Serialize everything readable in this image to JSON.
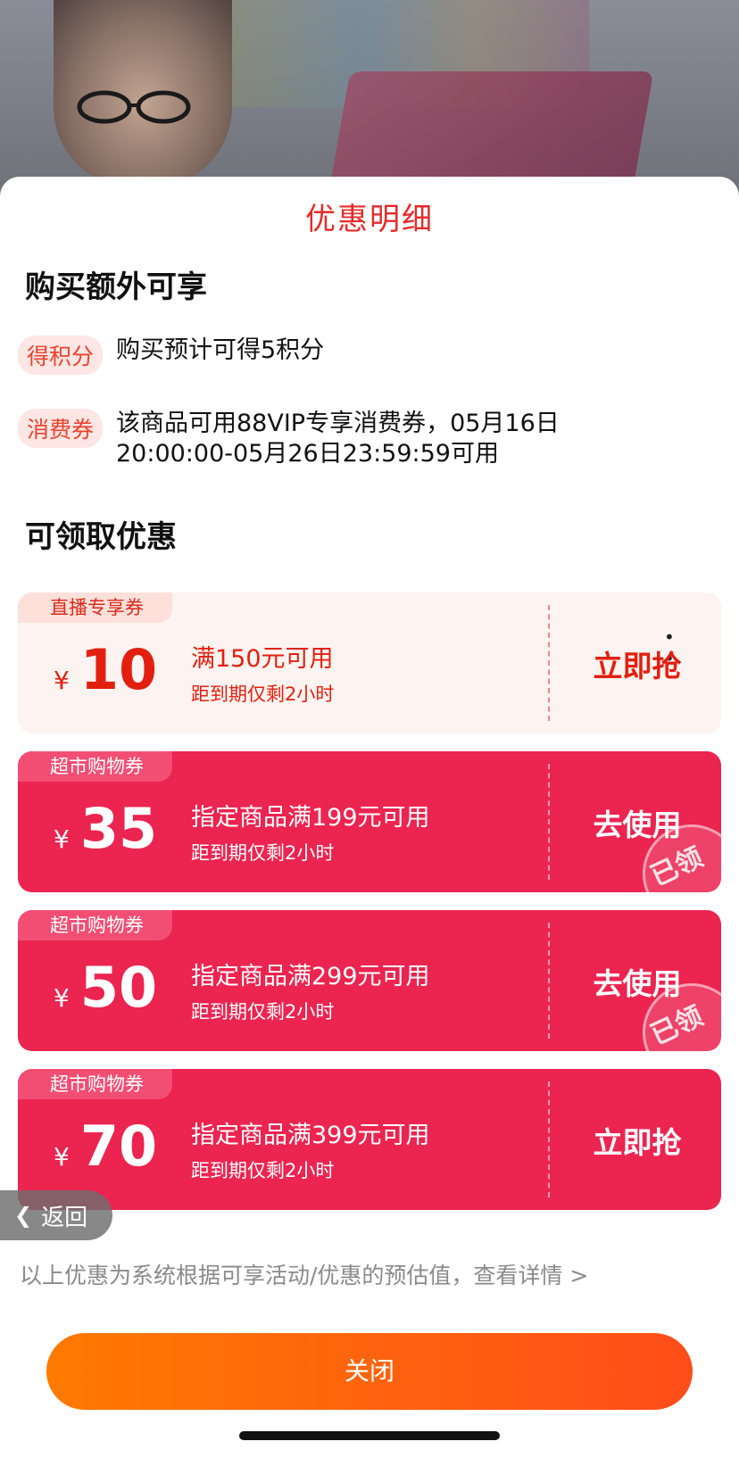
{
  "sheet": {
    "title": "优惠明细"
  },
  "extra_benefits": {
    "heading": "购买额外可享",
    "items": [
      {
        "tag": "得积分",
        "text": "购买预计可得5积分"
      },
      {
        "tag": "消费券",
        "text": "该商品可用88VIP专享消费券，05月16日 20:00:00-05月26日23:59:59可用"
      }
    ]
  },
  "available_offers": {
    "heading": "可领取优惠",
    "coupons": [
      {
        "tag": "直播专享券",
        "currency": "¥",
        "amount": "10",
        "condition": "满150元可用",
        "expiry": "距到期仅剩2小时",
        "action": "立即抢",
        "claimed": false,
        "style": "light"
      },
      {
        "tag": "超市购物券",
        "currency": "¥",
        "amount": "35",
        "condition": "指定商品满199元可用",
        "expiry": "距到期仅剩2小时",
        "action": "去使用",
        "claimed": true,
        "claimed_label": "已领",
        "style": "red"
      },
      {
        "tag": "超市购物券",
        "currency": "¥",
        "amount": "50",
        "condition": "指定商品满299元可用",
        "expiry": "距到期仅剩2小时",
        "action": "去使用",
        "claimed": true,
        "claimed_label": "已领",
        "style": "red"
      },
      {
        "tag": "超市购物券",
        "currency": "¥",
        "amount": "70",
        "condition": "指定商品满399元可用",
        "expiry": "距到期仅剩2小时",
        "action": "立即抢",
        "claimed": false,
        "style": "red"
      }
    ]
  },
  "back_button": {
    "label": "返回",
    "icon": "chevron-left-icon"
  },
  "footnote": "以上优惠为系统根据可享活动/优惠的预估值，查看详情 >",
  "close_button": {
    "label": "关闭"
  },
  "colors": {
    "accent_red": "#e32a2a",
    "coupon_red": "#ec2450",
    "button_orange_start": "#ff7a00",
    "button_orange_end": "#ff4d1a"
  }
}
